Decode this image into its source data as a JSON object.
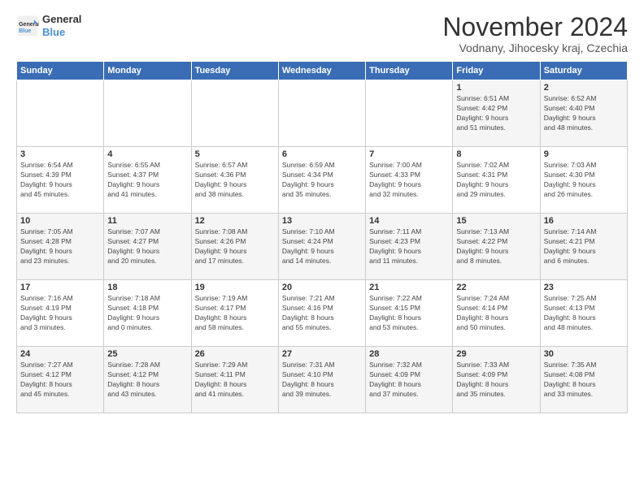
{
  "logo": {
    "line1": "General",
    "line2": "Blue"
  },
  "title": "November 2024",
  "subtitle": "Vodnany, Jihocesky kraj, Czechia",
  "days_header": [
    "Sunday",
    "Monday",
    "Tuesday",
    "Wednesday",
    "Thursday",
    "Friday",
    "Saturday"
  ],
  "weeks": [
    [
      {
        "day": "",
        "info": ""
      },
      {
        "day": "",
        "info": ""
      },
      {
        "day": "",
        "info": ""
      },
      {
        "day": "",
        "info": ""
      },
      {
        "day": "",
        "info": ""
      },
      {
        "day": "1",
        "info": "Sunrise: 6:51 AM\nSunset: 4:42 PM\nDaylight: 9 hours\nand 51 minutes."
      },
      {
        "day": "2",
        "info": "Sunrise: 6:52 AM\nSunset: 4:40 PM\nDaylight: 9 hours\nand 48 minutes."
      }
    ],
    [
      {
        "day": "3",
        "info": "Sunrise: 6:54 AM\nSunset: 4:39 PM\nDaylight: 9 hours\nand 45 minutes."
      },
      {
        "day": "4",
        "info": "Sunrise: 6:55 AM\nSunset: 4:37 PM\nDaylight: 9 hours\nand 41 minutes."
      },
      {
        "day": "5",
        "info": "Sunrise: 6:57 AM\nSunset: 4:36 PM\nDaylight: 9 hours\nand 38 minutes."
      },
      {
        "day": "6",
        "info": "Sunrise: 6:59 AM\nSunset: 4:34 PM\nDaylight: 9 hours\nand 35 minutes."
      },
      {
        "day": "7",
        "info": "Sunrise: 7:00 AM\nSunset: 4:33 PM\nDaylight: 9 hours\nand 32 minutes."
      },
      {
        "day": "8",
        "info": "Sunrise: 7:02 AM\nSunset: 4:31 PM\nDaylight: 9 hours\nand 29 minutes."
      },
      {
        "day": "9",
        "info": "Sunrise: 7:03 AM\nSunset: 4:30 PM\nDaylight: 9 hours\nand 26 minutes."
      }
    ],
    [
      {
        "day": "10",
        "info": "Sunrise: 7:05 AM\nSunset: 4:28 PM\nDaylight: 9 hours\nand 23 minutes."
      },
      {
        "day": "11",
        "info": "Sunrise: 7:07 AM\nSunset: 4:27 PM\nDaylight: 9 hours\nand 20 minutes."
      },
      {
        "day": "12",
        "info": "Sunrise: 7:08 AM\nSunset: 4:26 PM\nDaylight: 9 hours\nand 17 minutes."
      },
      {
        "day": "13",
        "info": "Sunrise: 7:10 AM\nSunset: 4:24 PM\nDaylight: 9 hours\nand 14 minutes."
      },
      {
        "day": "14",
        "info": "Sunrise: 7:11 AM\nSunset: 4:23 PM\nDaylight: 9 hours\nand 11 minutes."
      },
      {
        "day": "15",
        "info": "Sunrise: 7:13 AM\nSunset: 4:22 PM\nDaylight: 9 hours\nand 8 minutes."
      },
      {
        "day": "16",
        "info": "Sunrise: 7:14 AM\nSunset: 4:21 PM\nDaylight: 9 hours\nand 6 minutes."
      }
    ],
    [
      {
        "day": "17",
        "info": "Sunrise: 7:16 AM\nSunset: 4:19 PM\nDaylight: 9 hours\nand 3 minutes."
      },
      {
        "day": "18",
        "info": "Sunrise: 7:18 AM\nSunset: 4:18 PM\nDaylight: 9 hours\nand 0 minutes."
      },
      {
        "day": "19",
        "info": "Sunrise: 7:19 AM\nSunset: 4:17 PM\nDaylight: 8 hours\nand 58 minutes."
      },
      {
        "day": "20",
        "info": "Sunrise: 7:21 AM\nSunset: 4:16 PM\nDaylight: 8 hours\nand 55 minutes."
      },
      {
        "day": "21",
        "info": "Sunrise: 7:22 AM\nSunset: 4:15 PM\nDaylight: 8 hours\nand 53 minutes."
      },
      {
        "day": "22",
        "info": "Sunrise: 7:24 AM\nSunset: 4:14 PM\nDaylight: 8 hours\nand 50 minutes."
      },
      {
        "day": "23",
        "info": "Sunrise: 7:25 AM\nSunset: 4:13 PM\nDaylight: 8 hours\nand 48 minutes."
      }
    ],
    [
      {
        "day": "24",
        "info": "Sunrise: 7:27 AM\nSunset: 4:12 PM\nDaylight: 8 hours\nand 45 minutes."
      },
      {
        "day": "25",
        "info": "Sunrise: 7:28 AM\nSunset: 4:12 PM\nDaylight: 8 hours\nand 43 minutes."
      },
      {
        "day": "26",
        "info": "Sunrise: 7:29 AM\nSunset: 4:11 PM\nDaylight: 8 hours\nand 41 minutes."
      },
      {
        "day": "27",
        "info": "Sunrise: 7:31 AM\nSunset: 4:10 PM\nDaylight: 8 hours\nand 39 minutes."
      },
      {
        "day": "28",
        "info": "Sunrise: 7:32 AM\nSunset: 4:09 PM\nDaylight: 8 hours\nand 37 minutes."
      },
      {
        "day": "29",
        "info": "Sunrise: 7:33 AM\nSunset: 4:09 PM\nDaylight: 8 hours\nand 35 minutes."
      },
      {
        "day": "30",
        "info": "Sunrise: 7:35 AM\nSunset: 4:08 PM\nDaylight: 8 hours\nand 33 minutes."
      }
    ]
  ]
}
